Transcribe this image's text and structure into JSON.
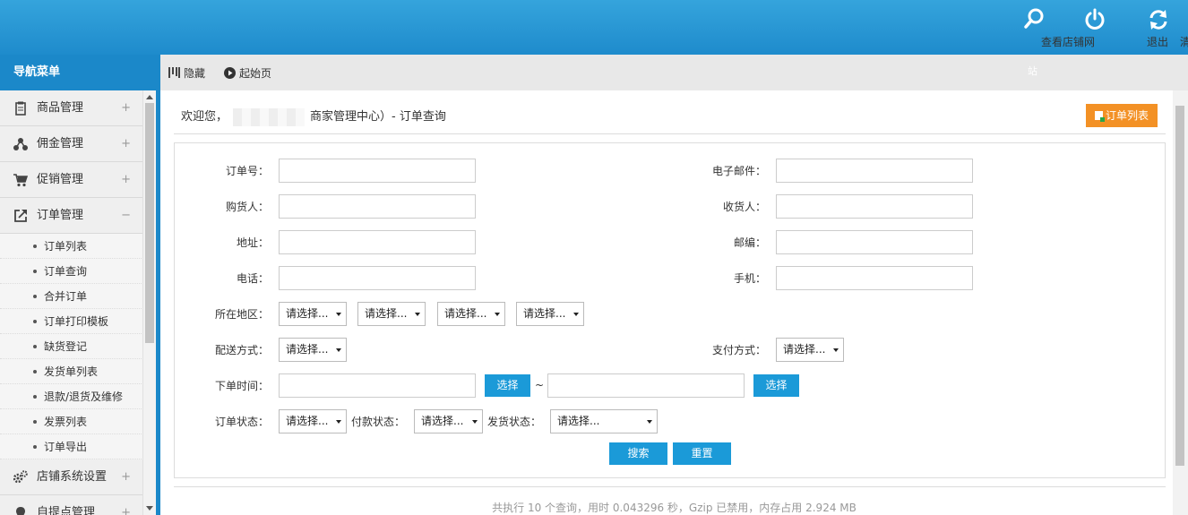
{
  "header": {
    "actions": [
      {
        "label": "查看店铺网",
        "icon": "search-icon"
      },
      {
        "label": "退出",
        "icon": "power-icon"
      },
      {
        "label": "清除缓存",
        "icon": "refresh-icon"
      }
    ]
  },
  "sidebar": {
    "title": "导航菜单",
    "groups": [
      {
        "label": "商品管理",
        "icon": "clipboard-icon",
        "toggle": "+"
      },
      {
        "label": "佣金管理",
        "icon": "share-icon",
        "toggle": "+"
      },
      {
        "label": "促销管理",
        "icon": "cart-icon",
        "toggle": "+"
      },
      {
        "label": "订单管理",
        "icon": "export-icon",
        "toggle": "−"
      }
    ],
    "sub_items": [
      "订单列表",
      "订单查询",
      "合并订单",
      "订单打印模板",
      "缺货登记",
      "发货单列表",
      "退款/退货及维修",
      "发票列表",
      "订单导出"
    ],
    "after_groups": [
      {
        "label": "店铺系统设置",
        "icon": "gears-icon",
        "toggle": "+"
      },
      {
        "label": "自提点管理",
        "icon": "location-icon",
        "toggle": "+"
      }
    ]
  },
  "toolbar": {
    "hide_label": "隐藏",
    "home_label": "起始页",
    "stray_text": "站"
  },
  "main": {
    "welcome": "欢迎您，",
    "breadcrumb_tail": "商家管理中心）- 订单查询",
    "order_list_button": "订单列表"
  },
  "form": {
    "order_no_label": "订单号：",
    "email_label": "电子邮件：",
    "buyer_label": "购货人：",
    "consignee_label": "收货人：",
    "address_label": "地址：",
    "zipcode_label": "邮编：",
    "phone_label": "电话：",
    "mobile_label": "手机：",
    "region_label": "所在地区：",
    "shipping_label": "配送方式：",
    "payment_label": "支付方式：",
    "order_time_label": "下单时间：",
    "order_status_label": "订单状态：",
    "pay_status_label": "付款状态：",
    "ship_status_label": "发货状态：",
    "select_placeholder": "请选择...",
    "pick_button": "选择",
    "range_sep": "~",
    "search_button": "搜索",
    "reset_button": "重置"
  },
  "footer": {
    "stats": "共执行 10 个查询，用时 0.043296 秒，Gzip 已禁用，内存占用 2.924 MB"
  },
  "colors": {
    "header_blue": "#2a99d6",
    "nav_blue": "#1b88c9",
    "button_blue": "#1b9ad8",
    "button_orange": "#f39125"
  }
}
